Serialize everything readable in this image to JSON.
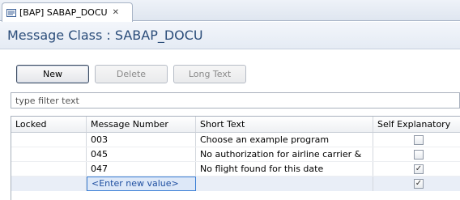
{
  "tab": {
    "label": "[BAP] SABAP_DOCU",
    "close_glyph": "✕"
  },
  "header": {
    "title": "Message Class : SABAP_DOCU"
  },
  "toolbar": {
    "new_label": "New",
    "delete_label": "Delete",
    "long_text_label": "Long Text"
  },
  "filter": {
    "placeholder": "type filter text",
    "value": ""
  },
  "table": {
    "columns": [
      "Locked",
      "Message Number",
      "Short Text",
      "Self Explanatory"
    ],
    "rows": [
      {
        "locked": "",
        "number": "003",
        "short_text": "Choose an example program",
        "self_explanatory": false
      },
      {
        "locked": "",
        "number": "045",
        "short_text": "No authorization for airline carrier &",
        "self_explanatory": false
      },
      {
        "locked": "",
        "number": "047",
        "short_text": "No flight found for this date",
        "self_explanatory": true
      }
    ],
    "new_row": {
      "placeholder": "<Enter new value>",
      "self_explanatory": true
    }
  },
  "colors": {
    "title": "#2b4d7a",
    "selection": "#dde8f8",
    "focus_border": "#3c7fd6"
  }
}
